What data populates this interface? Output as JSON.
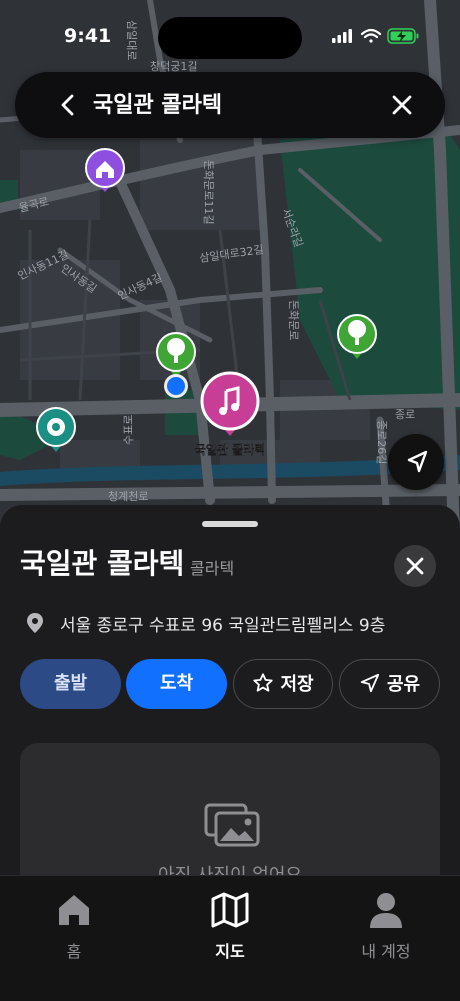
{
  "status_bar": {
    "time": "9:41"
  },
  "search": {
    "title": "국일관 콜라텍"
  },
  "map": {
    "pin_label": "국일관 콜라텍",
    "street_labels": [
      "창덕궁1길",
      "율곡로",
      "삼일대로32길",
      "인사동11길",
      "인사동4길",
      "인사동길",
      "돈화문로",
      "서순라길",
      "돈화문로11길",
      "삼일대로",
      "수표로",
      "종로26길",
      "청계천로",
      "종로"
    ]
  },
  "place": {
    "name": "국일관 콜라텍",
    "category": "콜라텍",
    "address": "서울 종로구 수표로 96 국일관드림펠리스 9층"
  },
  "actions": {
    "depart": "출발",
    "arrive": "도착",
    "save": "저장",
    "share": "공유"
  },
  "photos": {
    "empty_text": "아직 사진이 없어요"
  },
  "tabs": {
    "home": "홈",
    "map": "지도",
    "account": "내 계정"
  },
  "colors": {
    "accent": "#1270ff",
    "depart_bg": "#2c4a85",
    "pin_music": "#c83d96",
    "pin_park": "#3fa535",
    "pin_home": "#8e4fe0",
    "pin_teal": "#1b8f84"
  }
}
